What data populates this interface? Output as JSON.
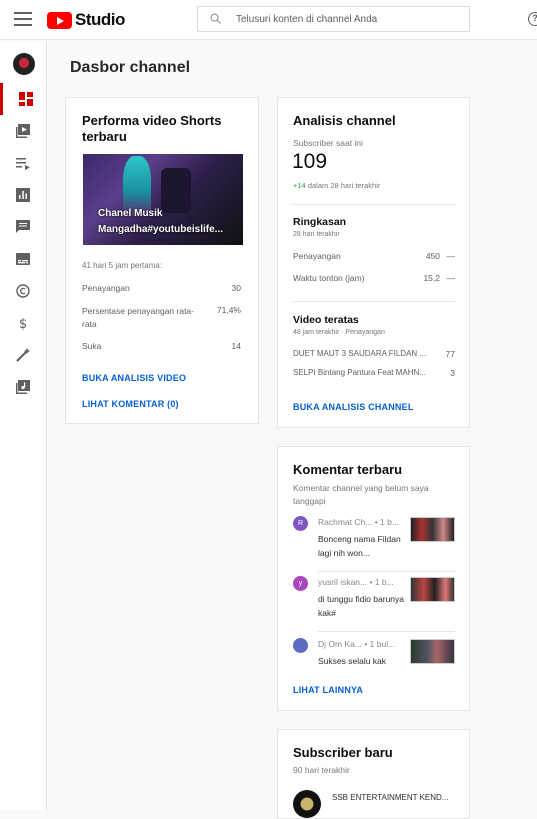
{
  "header": {
    "logo_text": "Studio",
    "search_placeholder": "Telusuri konten di channel Anda",
    "help_glyph": "?"
  },
  "page": {
    "title": "Dasbor channel"
  },
  "shorts_card": {
    "title": "Performa video Shorts terbaru",
    "thumbnail_caption": "Chanel Musik Mangadha#youtubeislife...",
    "period": "41 hari 5 jam pertama:",
    "stats": [
      {
        "label": "Penayangan",
        "value": "30"
      },
      {
        "label": "Persentase penayangan rata-rata",
        "value": "71,4%"
      },
      {
        "label": "Suka",
        "value": "14"
      }
    ],
    "analytics_link": "BUKA ANALISIS VIDEO",
    "comments_link": "LIHAT KOMENTAR (0)"
  },
  "analytics_card": {
    "title": "Analisis channel",
    "subscriber_label": "Subscriber saat ini",
    "subscriber_count": "109",
    "subscriber_change": "+14",
    "subscriber_change_period": "dalam 28 hari terakhir",
    "summary_title": "Ringkasan",
    "summary_period": "28 hari terakhir",
    "summary": [
      {
        "label": "Penayangan",
        "value": "450",
        "trend": "—"
      },
      {
        "label": "Waktu tonton (jam)",
        "value": "15,2",
        "trend": "—"
      }
    ],
    "top_title": "Video teratas",
    "top_period": "48 jam terakhir · Penayangan",
    "top_videos": [
      {
        "title": "DUET MAUT 3 SAUDARA FILDAN ...",
        "views": "77"
      },
      {
        "title": "SELPI Bintang Pantura Feat MAHN...",
        "views": "3"
      }
    ],
    "link": "BUKA ANALISIS CHANNEL"
  },
  "comments_card": {
    "title": "Komentar terbaru",
    "subtitle": "Komentar channel yang belum saya tanggapi",
    "comments": [
      {
        "initial": "R",
        "name": "Rachmat Ch...",
        "time": "• 1 b...",
        "text": "Bonceng nama Fildan lagi nih won...",
        "color": "#7e57c2"
      },
      {
        "initial": "y",
        "name": "yusril iskan...",
        "time": "• 1 b...",
        "text": "di tunggu fidio barunya kak#",
        "color": "#ab47bc"
      },
      {
        "initial": "",
        "name": "Dj Om Ka...",
        "time": "• 1 bul...",
        "text": "Sukses selalu kak",
        "color": "#5c6bc0"
      }
    ],
    "link": "LIHAT LAINNYA"
  },
  "subscribers_card": {
    "title": "Subscriber baru",
    "period": "90 hari terakhir",
    "subscribers": [
      {
        "name": "SSB ENTERTAINMENT KEND..."
      }
    ]
  },
  "colors": {
    "accent": "#cc0000",
    "link": "#065fd4",
    "positive": "#2ba640"
  }
}
